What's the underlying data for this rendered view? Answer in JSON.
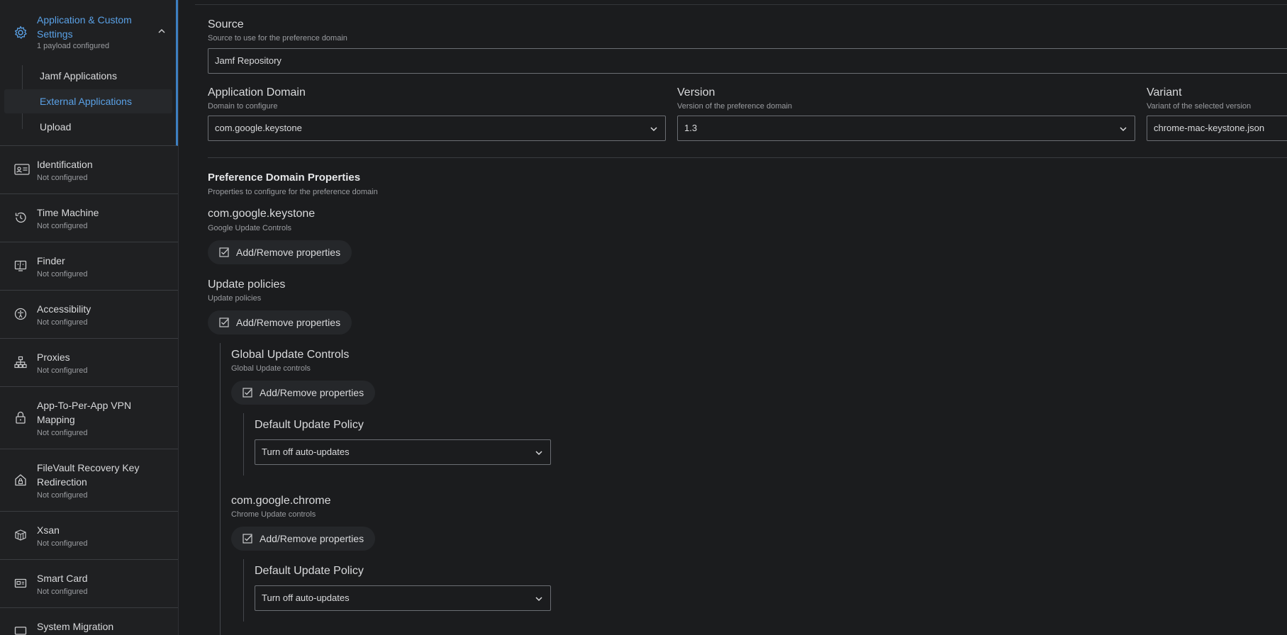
{
  "sidebar": {
    "active": {
      "title": "Application & Custom Settings",
      "subtitle": "1 payload configured",
      "icon": "gear-icon",
      "subitems": [
        {
          "label": "Jamf Applications",
          "selected": false
        },
        {
          "label": "External Applications",
          "selected": true
        },
        {
          "label": "Upload",
          "selected": false
        }
      ]
    },
    "items": [
      {
        "label": "Identification",
        "status": "Not configured",
        "icon": "id-card-icon"
      },
      {
        "label": "Time Machine",
        "status": "Not configured",
        "icon": "history-clock-icon"
      },
      {
        "label": "Finder",
        "status": "Not configured",
        "icon": "finder-icon"
      },
      {
        "label": "Accessibility",
        "status": "Not configured",
        "icon": "accessibility-icon"
      },
      {
        "label": "Proxies",
        "status": "Not configured",
        "icon": "network-icon"
      },
      {
        "label": "App-To-Per-App VPN Mapping",
        "status": "Not configured",
        "icon": "lock-icon"
      },
      {
        "label": "FileVault Recovery Key Redirection",
        "status": "Not configured",
        "icon": "house-lock-icon"
      },
      {
        "label": "Xsan",
        "status": "Not configured",
        "icon": "storage-icon"
      },
      {
        "label": "Smart Card",
        "status": "Not configured",
        "icon": "smart-card-icon"
      },
      {
        "label": "System Migration",
        "status": "",
        "icon": "migration-icon"
      }
    ]
  },
  "main": {
    "source": {
      "label": "Source",
      "help": "Source to use for the preference domain",
      "value": "Jamf Repository"
    },
    "app_domain": {
      "label": "Application Domain",
      "help": "Domain to configure",
      "value": "com.google.keystone"
    },
    "version": {
      "label": "Version",
      "help": "Version of the preference domain",
      "value": "1.3"
    },
    "variant": {
      "label": "Variant",
      "help": "Variant of the selected version",
      "value": "chrome-mac-keystone.json"
    },
    "properties": {
      "title": "Preference Domain Properties",
      "help": "Properties to configure for the preference domain"
    },
    "keystone": {
      "title": "com.google.keystone",
      "help": "Google Update Controls"
    },
    "add_remove_label": "Add/Remove properties",
    "update_policies": {
      "title": "Update policies",
      "help": "Update policies"
    },
    "global_update": {
      "title": "Global Update Controls",
      "help": "Global Update controls"
    },
    "default_policy_1": {
      "title": "Default Update Policy",
      "value": "Turn off auto-updates"
    },
    "chrome": {
      "title": "com.google.chrome",
      "help": "Chrome Update controls"
    },
    "default_policy_2": {
      "title": "Default Update Policy",
      "value": "Turn off auto-updates"
    }
  },
  "colors": {
    "accent": "#5aa1e6",
    "background": "#1b1c1e",
    "sidebar": "#1f2022"
  }
}
